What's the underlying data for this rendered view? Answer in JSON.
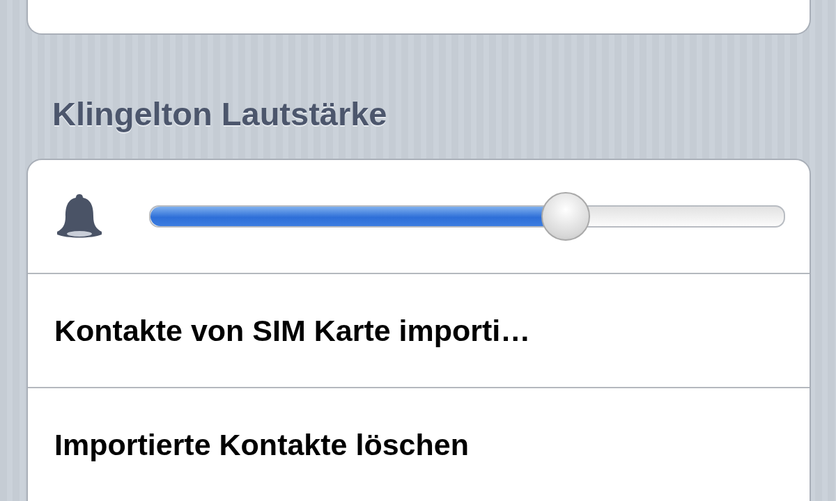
{
  "section_header": "Klingelton Lautstärke",
  "ringer_volume": {
    "level": 0.656
  },
  "rows": [
    {
      "label": "Kontakte von SIM Karte importi…"
    },
    {
      "label": "Importierte Kontakte löschen"
    }
  ]
}
